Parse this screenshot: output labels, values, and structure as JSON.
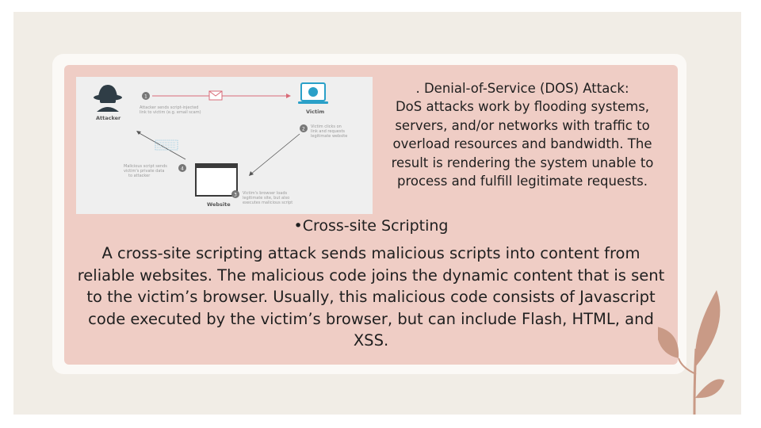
{
  "dos": {
    "title": ". Denial-of-Service (DOS) Attack:",
    "lines": [
      "DoS attacks work by flooding systems,",
      "servers, and/or networks with traffic to",
      "overload resources and bandwidth. The",
      "result is rendering the system unable to",
      "process and fulfill legitimate requests."
    ]
  },
  "xss": {
    "title": "•Cross-site Scripting",
    "body": "A cross-site scripting attack sends malicious scripts into content from reliable websites. The malicious code joins the dynamic content that is sent to the victim’s browser. Usually, this malicious code consists of Javascript code executed by the victim’s browser, but can include Flash, HTML, and XSS."
  },
  "diagram": {
    "attacker_label": "Attacker",
    "victim_label": "Victim",
    "website_label": "Website",
    "steps": [
      {
        "num": "1",
        "lines": [
          "Attacker sends script-injected",
          "link to victim (e.g. email scam)"
        ]
      },
      {
        "num": "2",
        "lines": [
          "Victim clicks on",
          "link and requests",
          "legitimate website"
        ]
      },
      {
        "num": "3",
        "lines": [
          "Victim's browser loads",
          "legitimate site, but also",
          "executes malicious script"
        ]
      },
      {
        "num": "4",
        "lines": [
          "Malicious script sends",
          "victim's private data",
          "to attacker"
        ]
      }
    ]
  },
  "colors": {
    "slide_bg": "#f1ede6",
    "card_bg": "#fbf9f6",
    "panel_bg": "#efcdc5",
    "accent_red": "#d96b78",
    "victim_blue": "#2aa0c8",
    "leaf": "#c99a86"
  }
}
